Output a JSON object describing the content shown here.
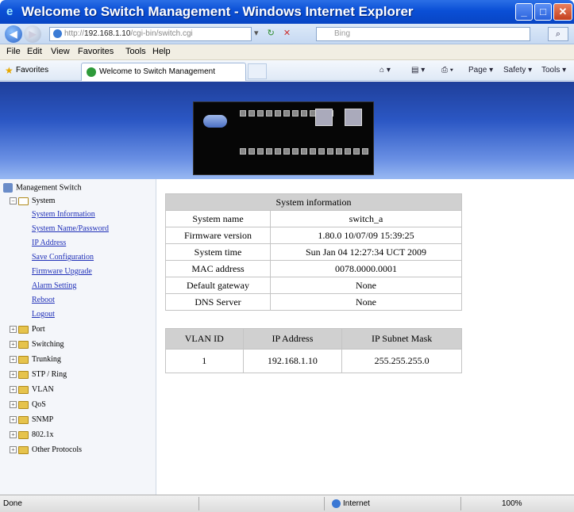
{
  "window": {
    "title": "Welcome to Switch Management - Windows Internet Explorer",
    "min_glyph": "_",
    "max_glyph": "□",
    "close_glyph": "✕"
  },
  "address_bar": {
    "url_prefix": "http://",
    "url_host": "192.168.1.10",
    "url_path": "/cgi-bin/switch.cgi",
    "search_placeholder": "Bing"
  },
  "menu": [
    "File",
    "Edit",
    "View",
    "Favorites",
    "Tools",
    "Help"
  ],
  "favorites_bar": {
    "favorites_label": "Favorites",
    "tab_label": "Welcome to Switch Management",
    "commands": [
      "Page ▾",
      "Safety ▾",
      "Tools ▾"
    ]
  },
  "tree": {
    "root": "Management Switch",
    "system_folder": "System",
    "system_links": [
      "System Information",
      "System Name/Password",
      "IP Address",
      "Save Configuration",
      "Firmware Upgrade",
      "Alarm Setting",
      "Reboot",
      "Logout"
    ],
    "folders": [
      "Port",
      "Switching",
      "Trunking",
      "STP / Ring",
      "VLAN",
      "QoS",
      "SNMP",
      "802.1x",
      "Other Protocols"
    ]
  },
  "system_info": {
    "title": "System information",
    "rows": [
      {
        "label": "System name",
        "value": "switch_a"
      },
      {
        "label": "Firmware version",
        "value": "1.80.0 10/07/09 15:39:25"
      },
      {
        "label": "System time",
        "value": "Sun Jan 04 12:27:34 UCT 2009"
      },
      {
        "label": "MAC address",
        "value": "0078.0000.0001"
      },
      {
        "label": "Default gateway",
        "value": "None"
      },
      {
        "label": "DNS Server",
        "value": "None"
      }
    ]
  },
  "vlan_table": {
    "headers": [
      "VLAN ID",
      "IP Address",
      "IP Subnet Mask"
    ],
    "rows": [
      {
        "vlan_id": "1",
        "ip": "192.168.1.10",
        "mask": "255.255.255.0"
      }
    ]
  },
  "status_bar": {
    "status": "Done",
    "zone": "Internet",
    "zoom": "100%"
  }
}
